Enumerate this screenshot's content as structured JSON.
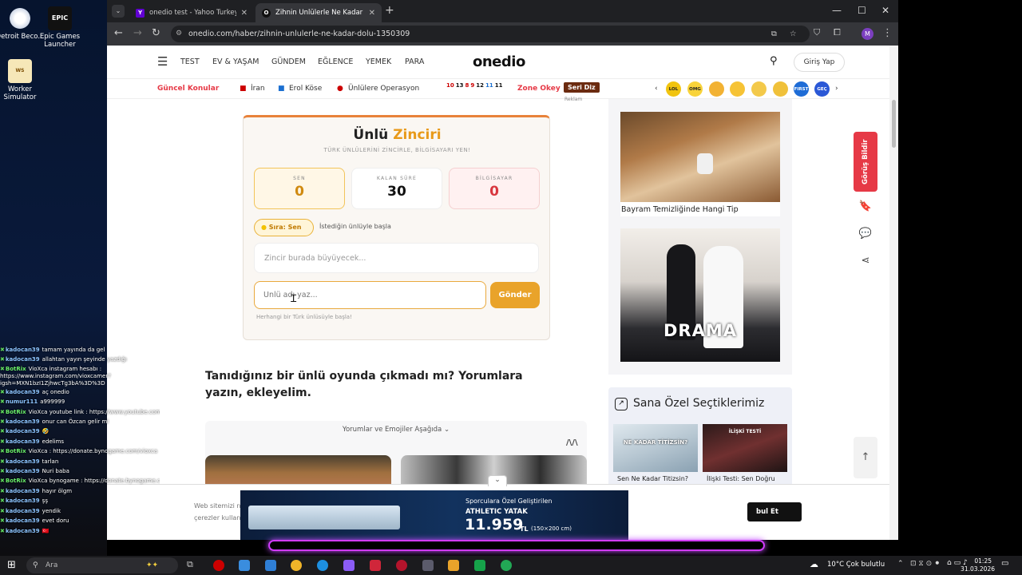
{
  "desktop": {
    "icons": [
      {
        "label": "Detroit Beco..."
      },
      {
        "label": "Epic Games Launcher"
      },
      {
        "label": "Worker Simulator"
      }
    ]
  },
  "chat": [
    {
      "user": "kadocan39",
      "msg": "tamam yayında da gel"
    },
    {
      "user": "kadocan39",
      "msg": "allahtan yayın şeyinde yazdığı"
    },
    {
      "user": "BotRix",
      "msg": "VioXca instagram hesabı : https://www.instagram.com/vioxcamer?igsh=MXN1bzI1ZjhwcTg3bA%3D%3D"
    },
    {
      "user": "kadocan39",
      "msg": "aç onedio"
    },
    {
      "user": "numur111",
      "msg": "a999999"
    },
    {
      "user": "BotRix",
      "msg": "VioXca youtube link : https://www.youtube.com/@vioxca"
    },
    {
      "user": "kadocan39",
      "msg": "onur can Özcan gelir mi"
    },
    {
      "user": "kadocan39",
      "msg": "🤣"
    },
    {
      "user": "kadocan39",
      "msg": "edelims"
    },
    {
      "user": "BotRix",
      "msg": "VioXca : https://donate.bynogame.com/vioxca"
    },
    {
      "user": "kadocan39",
      "msg": "tarlan"
    },
    {
      "user": "kadocan39",
      "msg": "Nuri baba"
    },
    {
      "user": "BotRix",
      "msg": "VioXca bynogame : https://donate.bynogame.com/vioxca"
    },
    {
      "user": "kadocan39",
      "msg": "hayır ölgm"
    },
    {
      "user": "kadocan39",
      "msg": "şş"
    },
    {
      "user": "kadocan39",
      "msg": "yendik"
    },
    {
      "user": "kadocan39",
      "msg": "evet doru"
    },
    {
      "user": "kadocan39",
      "msg": "🇹🇷"
    }
  ],
  "browser": {
    "tabs": [
      {
        "title": "onedio test - Yahoo Turkey Ara",
        "favicon": "Y",
        "color": "#6001d2"
      },
      {
        "title": "Zihnin Ünlülerle Ne Kadar Dolu",
        "favicon": "O",
        "color": "#222"
      }
    ],
    "url": "onedio.com/haber/zihnin-unlulerle-ne-kadar-dolu-1350309",
    "profile_initial": "M"
  },
  "header": {
    "nav": [
      "TEST",
      "EV & YAŞAM",
      "GÜNDEM",
      "EĞLENCE",
      "YEMEK",
      "PARA"
    ],
    "logo": "onedio",
    "login": "Giriş Yap"
  },
  "topics": {
    "label": "Güncel Konular",
    "items": [
      "İran",
      "Erol Köse",
      "Ünlülere Operasyon"
    ],
    "numbers": [
      "10",
      "13",
      "8",
      "9",
      "12",
      "11",
      "11"
    ],
    "zone": "Zone Okey",
    "seri": "Seri Diz",
    "emojis": [
      "LOL",
      "OMG",
      "",
      "",
      "",
      "",
      "FIRST",
      "GEÇ"
    ]
  },
  "game": {
    "title_a": "Ünlü",
    "title_b": "Zinciri",
    "subtitle": "TÜRK ÜNLÜLERİNİ ZİNCİRLE, BİLGİSAYARI YEN!",
    "scores": [
      {
        "label": "SEN",
        "value": "0"
      },
      {
        "label": "KALAN SÜRE",
        "value": "30"
      },
      {
        "label": "BİLGİSAYAR",
        "value": "0"
      }
    ],
    "turn": "Sıra: Sen",
    "turn_hint": "İstediğin ünlüyle başla",
    "chain_placeholder": "Zincir burada büyüyecek...",
    "input_placeholder": "Ünlü adı yaz...",
    "send": "Gönder",
    "hint": "Herhangi bir Türk ünlüsüyle başla!"
  },
  "article": {
    "reklam": "Reklam",
    "question": "Tanıdığınız bir ünlü oyunda çıkmadı mı? Yorumlara yazın, ekleyelim.",
    "comments_toggle": "Yorumlar ve Emojiler Aşağıda"
  },
  "sidebar": {
    "card1_title": "Bayram Temizliğinde Hangi Tip",
    "drama_text": "DRAMA",
    "picks_title": "Sana Özel Seçtiklerimiz",
    "picks": [
      {
        "title": "Sen Ne Kadar Titizsin?",
        "badge": "NE KADAR TİTİZSİN?"
      },
      {
        "title": "İlişki Testi: Sen Doğru",
        "badge": "İLİŞKİ TESTİ"
      }
    ],
    "feedback": "Görüş Bildir"
  },
  "cookie": {
    "text1": "Web sitemizi n",
    "text2": "çerezler kullan",
    "button": "bul Et"
  },
  "ad": {
    "line1": "Sporculara Özel Geliştirilen",
    "line2": "ATHLETIC YATAK",
    "price": "11.959",
    "currency": "TL",
    "size": "(150×200 cm)"
  },
  "taskbar": {
    "search": "Ara",
    "weather": "10°C  Çok bulutlu",
    "time": "01:25",
    "date": "31.03.2026"
  }
}
